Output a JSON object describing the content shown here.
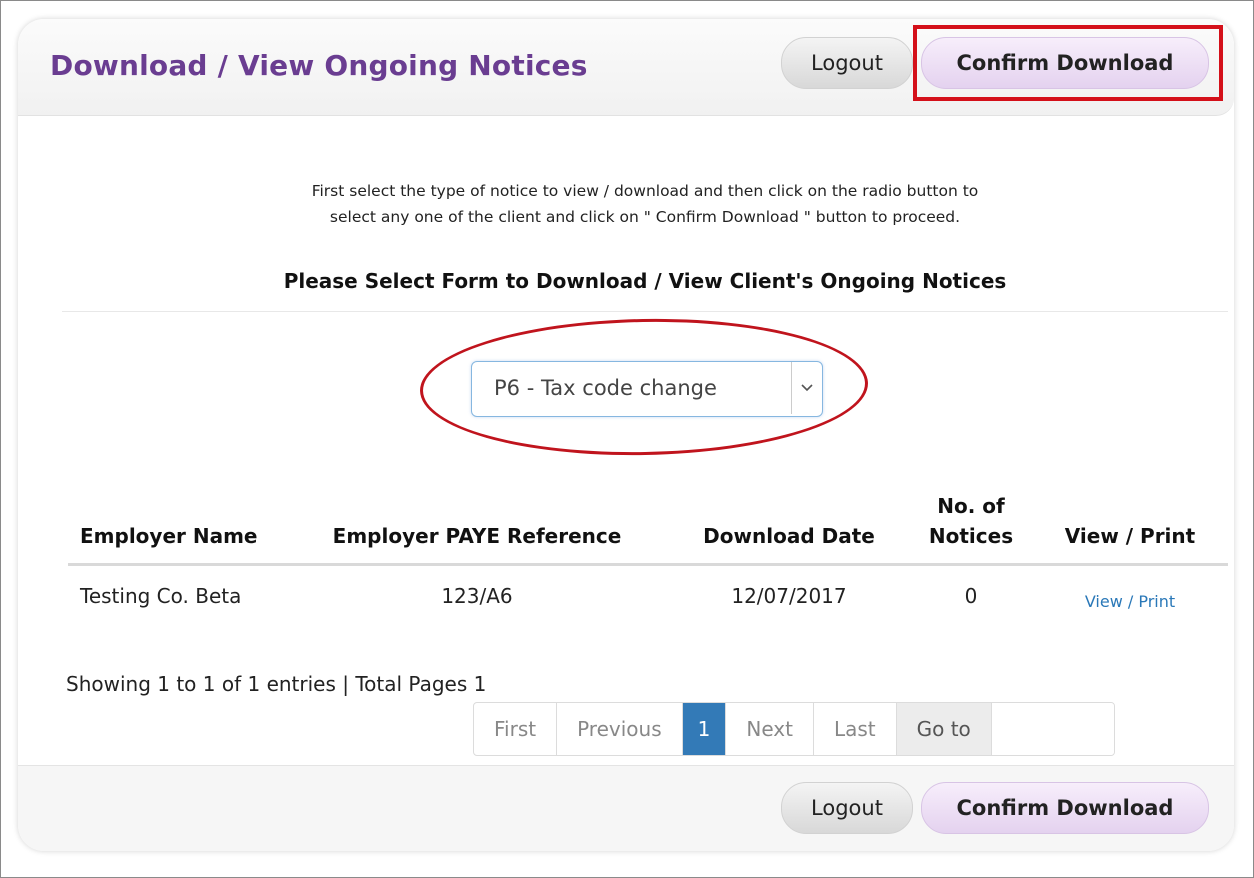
{
  "header": {
    "title": "Download / View Ongoing Notices",
    "logout_label": "Logout",
    "confirm_label": "Confirm Download"
  },
  "instructions": {
    "line1": "First select the type of notice to view / download and then click on the radio button to",
    "line2": "select any one of the client and click on \" Confirm Download \" button to proceed.",
    "subtitle": "Please Select Form to Download / View Client's Ongoing Notices"
  },
  "form_select": {
    "selected": "P6 - Tax code change"
  },
  "table": {
    "headers": {
      "employer_name": "Employer Name",
      "paye_reference": "Employer PAYE Reference",
      "download_date": "Download Date",
      "notices_line1": "No. of",
      "notices_line2": "Notices",
      "view_print": "View / Print"
    },
    "rows": [
      {
        "employer_name": "Testing Co. Beta",
        "paye_reference": "123/A6",
        "download_date": "12/07/2017",
        "notices": "0",
        "view_print": "View / Print"
      }
    ]
  },
  "pagination": {
    "showing": "Showing 1 to 1 of 1 entries | Total Pages 1",
    "first": "First",
    "previous": "Previous",
    "current": "1",
    "next": "Next",
    "last": "Last",
    "goto": "Go to",
    "goto_value": ""
  },
  "footer": {
    "logout_label": "Logout",
    "confirm_label": "Confirm Download"
  },
  "colors": {
    "title": "#6a3d91",
    "highlight": "#d4101a",
    "pager_active": "#337ab7",
    "link": "#2a78b8"
  }
}
